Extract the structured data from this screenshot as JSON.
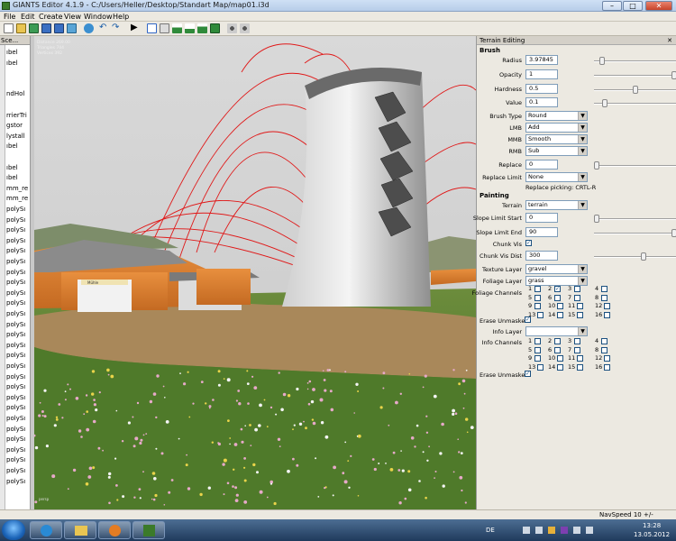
{
  "window": {
    "title": "GIANTS Editor 4.1.9 - C:/Users/Heller/Desktop/Standart Map/map01.i3d",
    "minimize": "–",
    "maximize": "□",
    "close": "✕"
  },
  "menu": [
    "File",
    "Edit",
    "Create",
    "View",
    "Window",
    "Help"
  ],
  "toolbar_icons": [
    "new-icon",
    "open-icon",
    "save-icon",
    "reload-icon",
    "save-all-icon",
    "refresh-icon",
    "undo-icon",
    "redo-icon",
    "play-icon",
    "select-icon",
    "move-icon",
    "terrain-up-icon",
    "terrain-down-icon",
    "terrain-smooth-icon",
    "paint-icon",
    "foliage-icon",
    "network-icon",
    "settings-icon"
  ],
  "scenegraph": {
    "header": "Sce...",
    "items": [
      "ıbel",
      "ıbel",
      "",
      "",
      "ndHol",
      "",
      "rrierTri",
      "gstor",
      "lystall",
      "ıbel",
      "",
      "ıbel",
      "ıbel",
      "mm_re",
      "mm_re",
      "polySı",
      "polySı",
      "polySı",
      "polySı",
      "polySı",
      "polySı",
      "polySı",
      "polySı",
      "polySı",
      "polySı",
      "polySı",
      "polySı",
      "polySı",
      "polySı",
      "polySı",
      "polySı",
      "polySı",
      "polySı",
      "polySı",
      "polySı",
      "polySı",
      "polySı",
      "polySı",
      "polySı",
      "polySı",
      "polySı",
      "polySı"
    ]
  },
  "viewport": {
    "info_lines": [
      "Distance 269.00",
      "Triangles 744",
      "Vertices 392"
    ],
    "sign_text": "Mühle",
    "corner_label": "persp"
  },
  "terrain_panel": {
    "title": "Terrain Editing",
    "close": "✕",
    "brush_section": "Brush",
    "radius_label": "Radius",
    "radius_value": "3.97845",
    "opacity_label": "Opacity",
    "opacity_value": "1",
    "hardness_label": "Hardness",
    "hardness_value": "0.5",
    "value_label": "Value",
    "value_value": "0.1",
    "brush_type_label": "Brush Type",
    "brush_type_value": "Round",
    "lmb_label": "LMB",
    "lmb_value": "Add",
    "mmb_label": "MMB",
    "mmb_value": "Smooth",
    "rmb_label": "RMB",
    "rmb_value": "Sub",
    "replace_label": "Replace",
    "replace_value": "0",
    "replace_limit_label": "Replace Limit",
    "replace_limit_value": "None",
    "replace_picking_hint": "Replace picking: CRTL-R",
    "painting_section": "Painting",
    "terrain_label": "Terrain",
    "terrain_value": "terrain",
    "slope_start_label": "Slope Limit Start",
    "slope_start_value": "0",
    "slope_end_label": "Slope Limit End",
    "slope_end_value": "90",
    "chunk_vis_label": "Chunk Vis",
    "chunk_vis_dist_label": "Chunk Vis Dist",
    "chunk_vis_dist_value": "300",
    "texture_layer_label": "Texture Layer",
    "texture_layer_value": "gravel",
    "foliage_layer_label": "Foliage Layer",
    "foliage_layer_value": "grass",
    "foliage_channels_label": "Foliage Channels",
    "foliage_checked": [
      2
    ],
    "erase_unmasked_label": "Erase Unmasked",
    "info_layer_label": "Info Layer",
    "info_layer_value": "",
    "info_channels_label": "Info Channels",
    "erase_unmasked2_label": "Erase Unmasked",
    "channel_numbers": [
      "1",
      "2",
      "3",
      "4",
      "5",
      "6",
      "7",
      "8",
      "9",
      "10",
      "11",
      "12",
      "13",
      "14",
      "15",
      "16"
    ],
    "check_mark": "✓",
    "dropdown_arrow": "▼"
  },
  "statusbar": {
    "navspeed": "NavSpeed 10 +/-"
  },
  "taskbar": {
    "lang": "DE",
    "time": "13:28",
    "date": "13.05.2012"
  }
}
